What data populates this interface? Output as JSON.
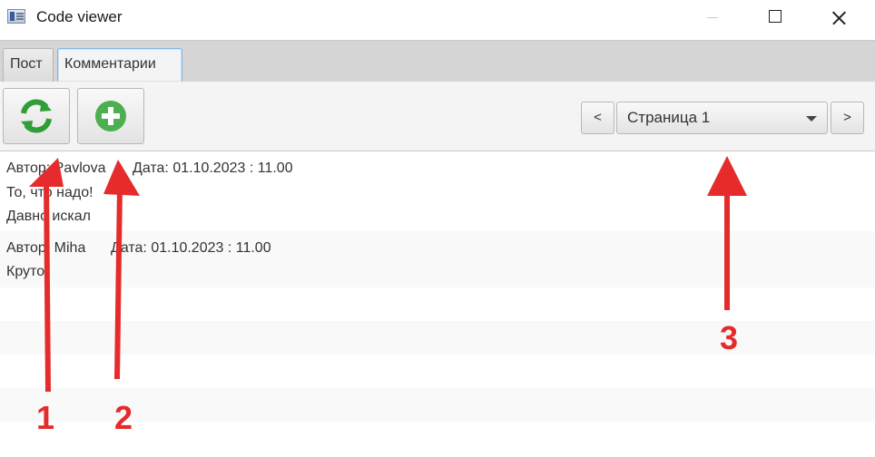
{
  "window": {
    "title": "Code viewer"
  },
  "tabs": [
    {
      "label": "Пост",
      "selected": false
    },
    {
      "label": "Комментарии",
      "selected": true
    }
  ],
  "toolbar": {
    "refresh_icon": "refresh-icon",
    "add_icon": "add-circle-icon",
    "prev_label": "<",
    "next_label": ">",
    "page_selected": "Страница 1"
  },
  "comments": [
    {
      "author_label": "Автор: Pavlova",
      "date_label": "Дата: 01.10.2023 : 11.00",
      "lines": [
        "То, что надо!",
        "Давно искал"
      ]
    },
    {
      "author_label": "Автор: Miha",
      "date_label": "Дата: 01.10.2023 : 11.00",
      "lines": [
        "Круто"
      ]
    }
  ],
  "annotations": [
    {
      "label": "1"
    },
    {
      "label": "2"
    },
    {
      "label": "3"
    }
  ],
  "colors": {
    "accent_green": "#4caf50",
    "annotation_red": "#e52b2b",
    "tab_focus_border": "#7fb7e6"
  }
}
